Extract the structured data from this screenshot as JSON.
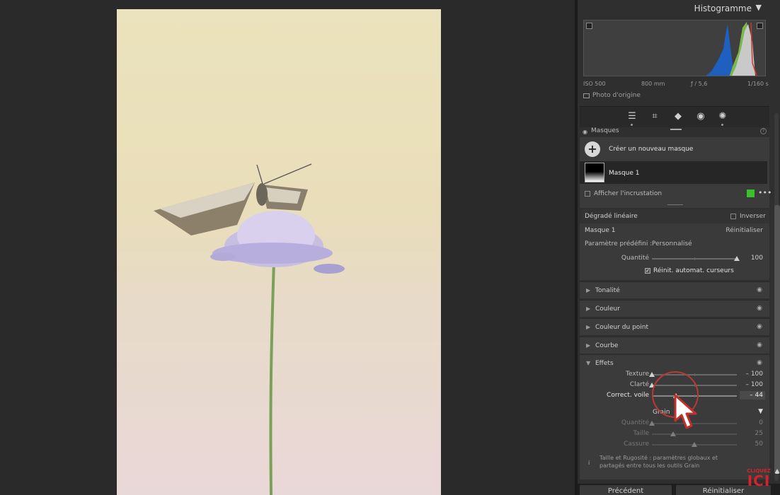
{
  "histogram": {
    "title": "Histogramme",
    "iso": "ISO 500",
    "focal": "800 mm",
    "aperture": "ƒ / 5,6",
    "shutter": "1/160 s",
    "original_photo_label": "Photo d'origine"
  },
  "masks": {
    "title": "Masques",
    "create_label": "Créer un nouveau masque",
    "mask_name": "Masque 1",
    "overlay_label": "Afficher l'incrustation",
    "overlay_color": "#39c02b"
  },
  "gradient": {
    "label": "Dégradé linéaire",
    "invert_label": "Inverser"
  },
  "mask_settings": {
    "title": "Masque 1",
    "reset_label": "Réinitialiser",
    "preset_label": "Paramètre prédéfini :",
    "preset_value": "Personnalisé",
    "quantity_label": "Quantité",
    "quantity_value": "100",
    "auto_reset_label": "Réinit. automat. curseurs"
  },
  "sections": {
    "tonality": "Tonalité",
    "color": "Couleur",
    "point_color": "Couleur du point",
    "curve": "Courbe"
  },
  "effects": {
    "title": "Effets",
    "texture_label": "Texture",
    "texture_value": "– 100",
    "clarity_label": "Clarté",
    "clarity_value": "– 100",
    "dehaze_label": "Correct. voile",
    "dehaze_value": "– 44",
    "grain_label": "Grain",
    "grain_amount_label": "Quantité",
    "grain_amount_value": "0",
    "grain_size_label": "Taille",
    "grain_size_value": "25",
    "grain_roughness_label": "Cassure",
    "grain_roughness_value": "50",
    "info_text": "Taille et Rugosité : paramètres globaux et partagés entre tous les outils Grain"
  },
  "slider_levels": {
    "quantity": 1.0,
    "texture": -1.0,
    "clarity": -1.0,
    "dehaze": -0.44,
    "grain_amount": 0,
    "grain_size": 0.25,
    "grain_roughness": 0.5
  },
  "bottom": {
    "previous_label": "Précédent",
    "reset_label": "Réinitialiser"
  },
  "watermark": {
    "top": "CLIQUEZ",
    "main": "ICI"
  },
  "icons": [
    "adjust-icon",
    "crop-icon",
    "eraser-icon",
    "redeye-icon",
    "mask-icon",
    "eye-icon",
    "help-icon",
    "info-icon"
  ]
}
